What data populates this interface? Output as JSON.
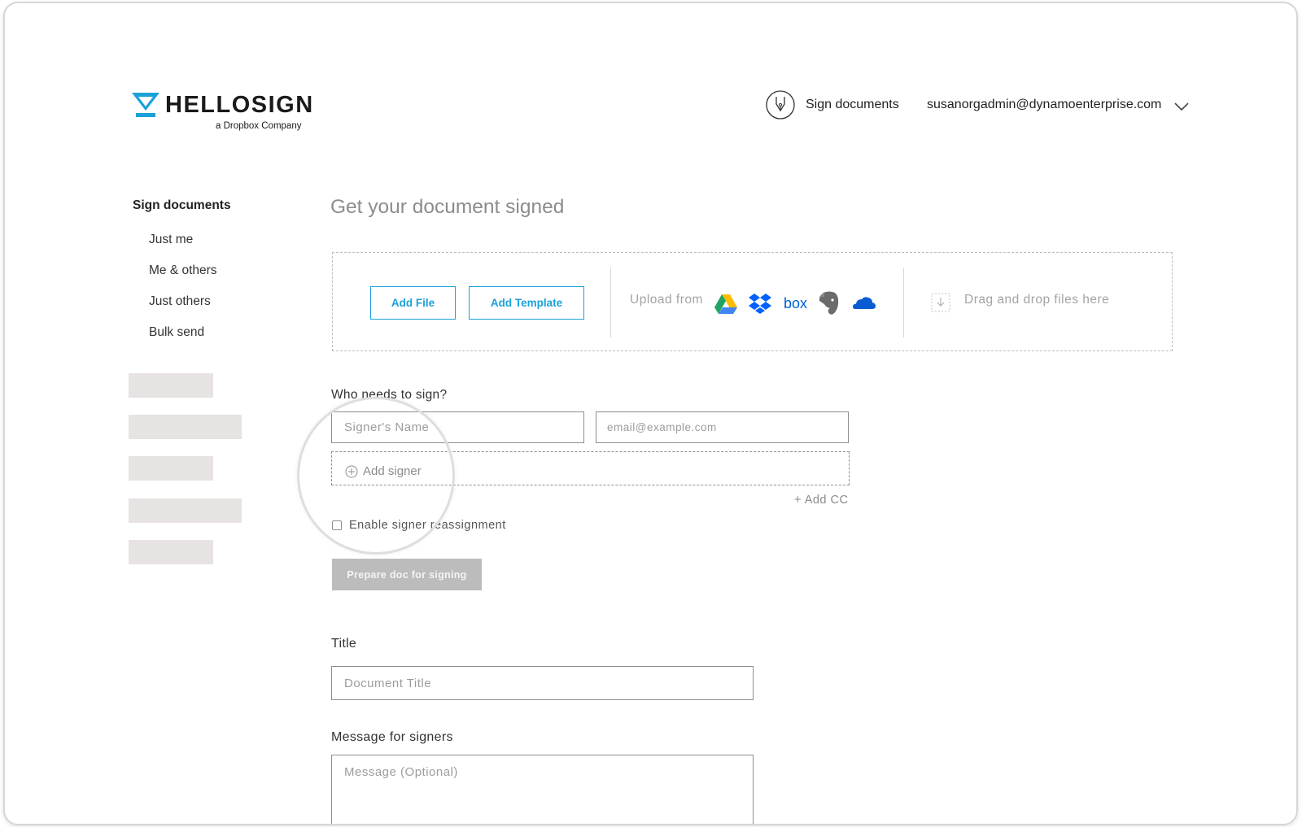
{
  "brand": {
    "name": "HELLOSIGN",
    "tagline": "a Dropbox Company",
    "logo_color": "#1aa1d9"
  },
  "header": {
    "sign_documents_label": "Sign documents",
    "account_email": "susanorgadmin@dynamoenterprise.com",
    "icons": [
      "pen-nib-icon",
      "chevron-down-icon"
    ]
  },
  "sidebar": {
    "title": "Sign documents",
    "items": [
      {
        "label": "Just me"
      },
      {
        "label": "Me & others"
      },
      {
        "label": "Just others"
      },
      {
        "label": "Bulk send"
      }
    ]
  },
  "main": {
    "title": "Get your document signed",
    "upload": {
      "add_file_label": "Add File",
      "add_template_label": "Add Template",
      "upload_from_label": "Upload from",
      "services": [
        "google-drive-icon",
        "dropbox-icon",
        "box-icon",
        "evernote-icon",
        "onedrive-icon"
      ],
      "drag_drop_label": "Drag and drop files here"
    },
    "signers": {
      "label": "Who needs to sign?",
      "name_placeholder": "Signer's Name",
      "email_placeholder": "email@example.com",
      "add_signer_label": "Add signer",
      "add_cc_label": "+ Add CC",
      "reassignment_label": "Enable signer reassignment",
      "reassignment_checked": false
    },
    "prepare_button_label": "Prepare doc for signing",
    "title_section": {
      "label": "Title",
      "placeholder": "Document Title"
    },
    "message_section": {
      "label": "Message for signers",
      "placeholder": "Message (Optional)"
    }
  },
  "colors": {
    "accent": "#1aa1d9",
    "placeholder_block": "#e6e3e2",
    "disabled_button": "#bcbcbc"
  }
}
